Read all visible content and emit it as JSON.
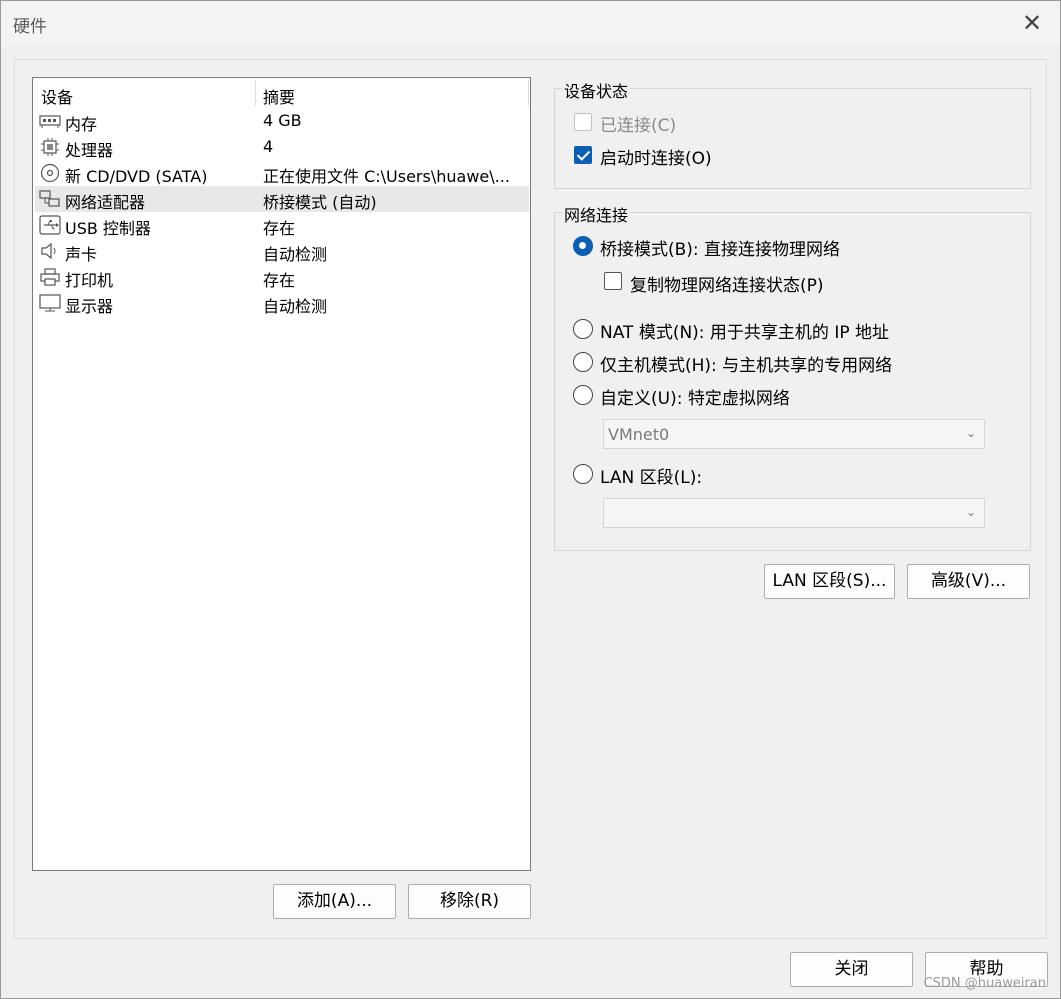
{
  "window": {
    "title": "硬件",
    "close_glyph": "✕"
  },
  "device_list": {
    "headers": [
      "设备",
      "摘要"
    ],
    "rows": [
      {
        "icon": "memory-icon",
        "name": "内存",
        "summary": "4 GB",
        "selected": false
      },
      {
        "icon": "processor-icon",
        "name": "处理器",
        "summary": "4",
        "selected": false
      },
      {
        "icon": "cd-dvd-icon",
        "name": "新 CD/DVD (SATA)",
        "summary": "正在使用文件 C:\\Users\\huawe\\...",
        "selected": false
      },
      {
        "icon": "network-adapter-icon",
        "name": "网络适配器",
        "summary": "桥接模式 (自动)",
        "selected": true
      },
      {
        "icon": "usb-icon",
        "name": "USB 控制器",
        "summary": "存在",
        "selected": false
      },
      {
        "icon": "sound-card-icon",
        "name": "声卡",
        "summary": "自动检测",
        "selected": false
      },
      {
        "icon": "printer-icon",
        "name": "打印机",
        "summary": "存在",
        "selected": false
      },
      {
        "icon": "display-icon",
        "name": "显示器",
        "summary": "自动检测",
        "selected": false
      }
    ],
    "add_label": "添加(A)...",
    "remove_label": "移除(R)"
  },
  "device_status": {
    "title": "设备状态",
    "connected": {
      "label": "已连接(C)",
      "checked": false,
      "enabled": false
    },
    "connect_at_power_on": {
      "label": "启动时连接(O)",
      "checked": true,
      "enabled": true
    }
  },
  "network_connection": {
    "title": "网络连接",
    "bridged": {
      "label": "桥接模式(B): 直接连接物理网络",
      "checked": true
    },
    "replicate": {
      "label": "复制物理网络连接状态(P)",
      "checked": false
    },
    "nat": {
      "label": "NAT 模式(N): 用于共享主机的 IP 地址",
      "checked": false
    },
    "host_only": {
      "label": "仅主机模式(H): 与主机共享的专用网络",
      "checked": false
    },
    "custom": {
      "label": "自定义(U): 特定虚拟网络",
      "checked": false
    },
    "custom_select_value": "VMnet0",
    "lan_segment": {
      "label": "LAN 区段(L):",
      "checked": false
    },
    "lan_select_value": ""
  },
  "buttons": {
    "lan_segments": "LAN 区段(S)...",
    "advanced": "高级(V)...",
    "close": "关闭",
    "help": "帮助"
  },
  "watermark": "CSDN @huaweiran",
  "colors": {
    "accent": "#0a5fb4",
    "selection": "#e8e8e8"
  }
}
